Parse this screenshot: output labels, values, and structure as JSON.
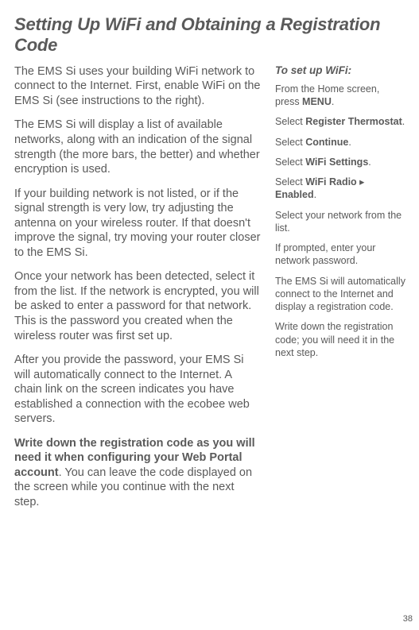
{
  "heading": "Setting Up WiFi and Obtaining a Registration Code",
  "main": {
    "p1": "The EMS Si uses your building WiFi network to connect to the Internet. First, enable WiFi on the EMS Si (see instructions to the right).",
    "p2": "The EMS Si will display a list of available networks, along with an indication of the signal strength (the more bars, the better) and whether encryption is used.",
    "p3": "If your building network is not listed, or if the signal strength is very low, try adjusting the antenna on your wireless router. If that doesn't improve the signal, try moving your router closer to the EMS Si.",
    "p4": "Once your network has been detected, select it from the list. If the network is encrypted, you will be asked to enter a password for that network. This is the password you created when the wireless router was first set up.",
    "p5": "After you provide the password, your EMS Si will automatically connect to the Internet. A chain link on the screen indicates you have established a connection with the ecobee web servers.",
    "p6_bold": "Write down the registration code as you will need it when configuring your Web Portal account",
    "p6_rest": ". You can leave the code displayed on the screen while you continue with the next step."
  },
  "side": {
    "heading": "To set up WiFi:",
    "s1_pre": "From the Home screen, press ",
    "s1_b": "MENU",
    "s1_post": ".",
    "s2_pre": "Select ",
    "s2_b": "Register Thermostat",
    "s2_post": ".",
    "s3_pre": "Select ",
    "s3_b": "Continue",
    "s3_post": ".",
    "s4_pre": "Select ",
    "s4_b": "WiFi Settings",
    "s4_post": ".",
    "s5_pre": "Select ",
    "s5_b1": "WiFi Radio",
    "s5_mid": " ▸ ",
    "s5_b2": "Enabled",
    "s5_post": ".",
    "s6": "Select your network from the list.",
    "s7": "If prompted, enter your network password.",
    "s8": "The EMS Si will automatically connect to the Internet and display a registration code.",
    "s9": "Write down the registration code; you will need it in the next step."
  },
  "page_number": "38"
}
